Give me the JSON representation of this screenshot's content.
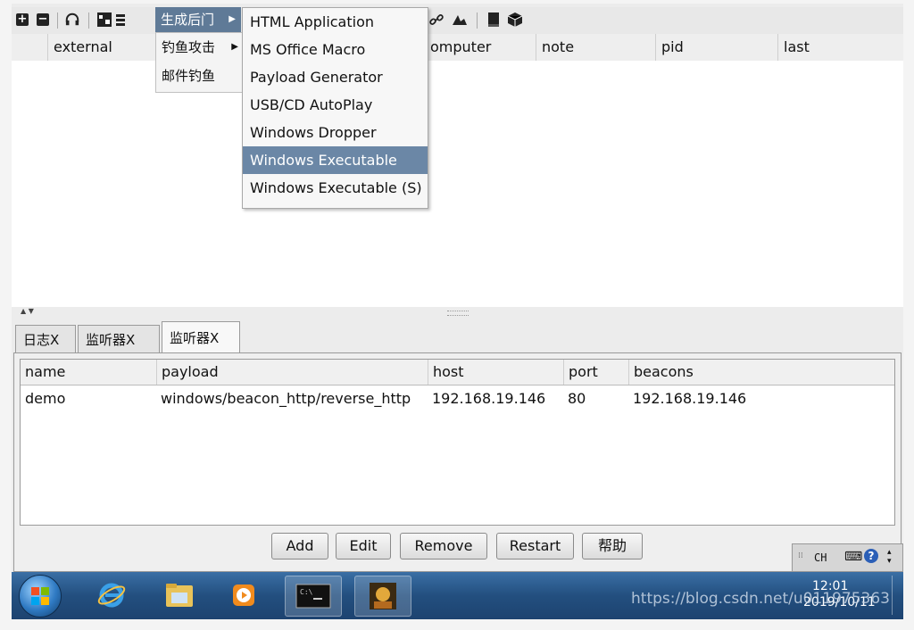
{
  "colors": {
    "menu_highlight": "#6b87a6",
    "menubar_selected": "#5f7a97",
    "taskbar": "#234f7f"
  },
  "menubar": {
    "selected_label": "生成后门"
  },
  "menu_level1": {
    "items": [
      {
        "label": "钓鱼攻击",
        "has_submenu": true
      },
      {
        "label": "邮件钓鱼",
        "has_submenu": false
      }
    ]
  },
  "menu_level2": {
    "items": [
      {
        "label": "HTML Application"
      },
      {
        "label": "MS Office Macro"
      },
      {
        "label": "Payload Generator"
      },
      {
        "label": "USB/CD AutoPlay"
      },
      {
        "label": "Windows Dropper"
      },
      {
        "label": "Windows Executable",
        "selected": true
      },
      {
        "label": "Windows Executable (S)"
      }
    ]
  },
  "top_table": {
    "columns": [
      "external",
      "omputer",
      "note",
      "pid",
      "last"
    ]
  },
  "tabs": [
    {
      "label": "日志X",
      "active": false
    },
    {
      "label": "监听器X",
      "active": false
    },
    {
      "label": "监听器X",
      "active": true
    }
  ],
  "listeners": {
    "columns": [
      "name",
      "payload",
      "host",
      "port",
      "beacons"
    ],
    "rows": [
      [
        "demo",
        "windows/beacon_http/reverse_http",
        "192.168.19.146",
        "80",
        "192.168.19.146"
      ]
    ]
  },
  "buttons": {
    "add": "Add",
    "edit": "Edit",
    "remove": "Remove",
    "restart": "Restart",
    "help": "帮助"
  },
  "tray": {
    "lang": "CH",
    "time": "12:01",
    "date": "2019/10/11"
  },
  "taskbar_items": [
    "ie-icon",
    "explorer-icon",
    "media-player-icon",
    "cmd-icon",
    "app-icon"
  ],
  "watermark": "https://blog.csdn.net/u011975363"
}
